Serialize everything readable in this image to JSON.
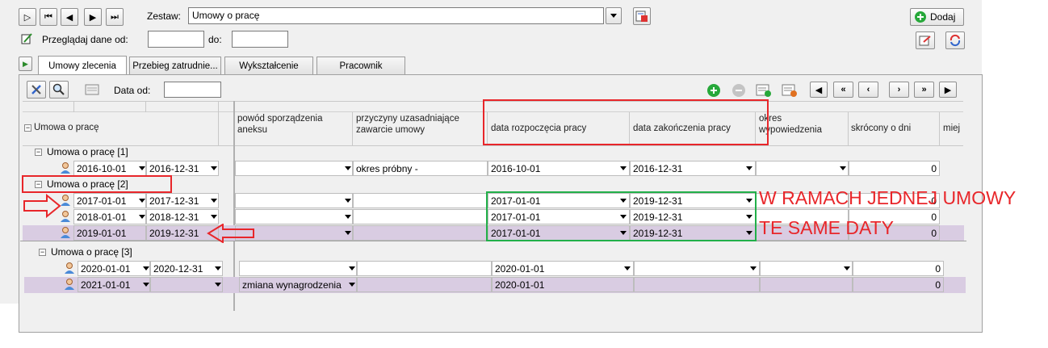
{
  "toolbar": {
    "zestaw_label": "Zestaw:",
    "zestaw_value": "Umowy o pracę",
    "przegladaj_label": "Przeglądaj dane od:",
    "do_label": "do:",
    "dodaj_label": "Dodaj"
  },
  "tabs": [
    "Umowy zlecenia",
    "Przebieg zatrudnie...",
    "Wykształcenie",
    "Pracownik"
  ],
  "grid_toolbar": {
    "data_od_label": "Data od:"
  },
  "columns": {
    "tree": "Umowa o pracę",
    "powod": "powód sporządzenia aneksu",
    "przyczyny": "przyczyny uzasadniające zawarcie umowy",
    "data_rozp": "data rozpoczęcia pracy",
    "data_zak": "data zakończenia pracy",
    "okres": "okres wypowiedzenia",
    "skrocony": "skrócony o dni",
    "miej": "miej"
  },
  "groups": [
    {
      "label": "Umowa o pracę [1]"
    },
    {
      "label": "Umowa o pracę [2]"
    },
    {
      "label": "Umowa o pracę [3]"
    }
  ],
  "rows": [
    {
      "from": "2016-10-01",
      "to": "2016-12-31",
      "powod": "",
      "przyczyny": "okres próbny -",
      "rozp": "2016-10-01",
      "zak": "2016-12-31",
      "dni": "0"
    },
    {
      "from": "2017-01-01",
      "to": "2017-12-31",
      "powod": "",
      "przyczyny": "",
      "rozp": "2017-01-01",
      "zak": "2019-12-31",
      "dni": "0"
    },
    {
      "from": "2018-01-01",
      "to": "2018-12-31",
      "powod": "",
      "przyczyny": "",
      "rozp": "2017-01-01",
      "zak": "2019-12-31",
      "dni": "0"
    },
    {
      "from": "2019-01-01",
      "to": "2019-12-31",
      "powod": "",
      "przyczyny": "",
      "rozp": "2017-01-01",
      "zak": "2019-12-31",
      "dni": "0"
    },
    {
      "from": "2020-01-01",
      "to": "2020-12-31",
      "powod": "",
      "przyczyny": "",
      "rozp": "2020-01-01",
      "zak": "",
      "dni": "0"
    },
    {
      "from": "2021-01-01",
      "to": "",
      "powod": "zmiana wynagrodzenia",
      "przyczyny": "",
      "rozp": "2020-01-01",
      "zak": "",
      "dni": "0"
    }
  ],
  "annotation": {
    "line1": "W RAMACH JEDNEJ UMOWY",
    "line2": "TE SAME DATY"
  },
  "colors": {
    "annotation_red": "#e8262a",
    "highlight_green": "#22b04a",
    "selected_row": "#d9cce2"
  }
}
